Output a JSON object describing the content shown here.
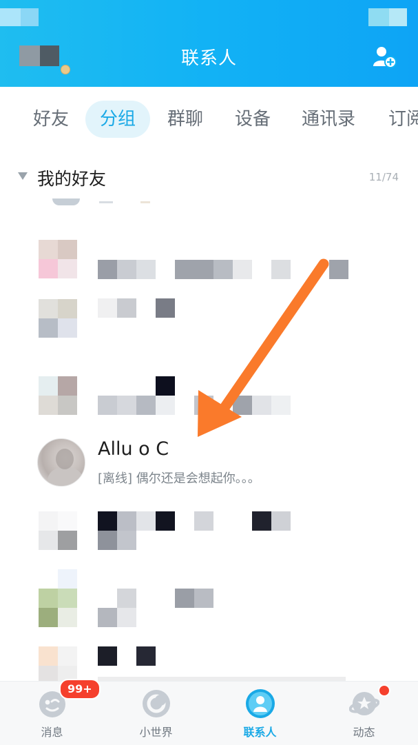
{
  "header": {
    "title": "联系人",
    "gradient": [
      "#1fbdf0",
      "#0ea4f5"
    ]
  },
  "tabs": [
    {
      "label": "好友"
    },
    {
      "label": "分组"
    },
    {
      "label": "群聊"
    },
    {
      "label": "设备"
    },
    {
      "label": "通讯录"
    },
    {
      "label": "订阅"
    }
  ],
  "group": {
    "title": "我的好友",
    "count": "11/74"
  },
  "highlighted_contact": {
    "name": "Allu      o     C",
    "status": "[离线] 偶尔还是会想起你。。。"
  },
  "annotation": {
    "type": "arrow",
    "color": "#fa7a2b",
    "points_to": "highlighted-contact"
  },
  "bottom_nav": {
    "items": [
      {
        "label": "消息",
        "icon": "chat-face-icon",
        "badge": "99+"
      },
      {
        "label": "小世界",
        "icon": "small-world-icon"
      },
      {
        "label": "联系人",
        "icon": "contacts-icon",
        "active": true
      },
      {
        "label": "动态",
        "icon": "planet-star-icon",
        "dot": true
      }
    ]
  },
  "colors": {
    "accent": "#1aa9e6",
    "badge": "#f5402d"
  }
}
